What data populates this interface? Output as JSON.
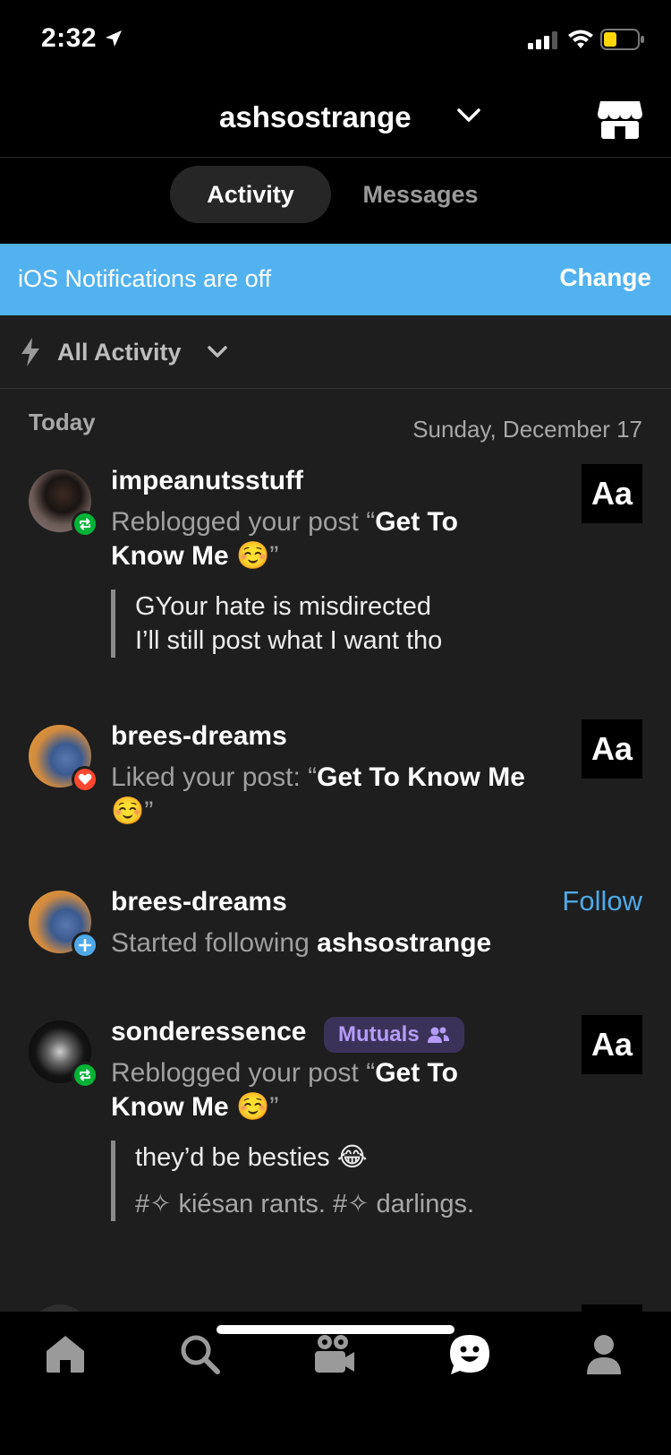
{
  "status_bar": {
    "time": "2:32"
  },
  "header": {
    "title": "ashsostrange"
  },
  "tabs": [
    {
      "label": "Activity",
      "selected": true
    },
    {
      "label": "Messages",
      "selected": false
    }
  ],
  "banner": {
    "text": "iOS Notifications are off",
    "action": "Change",
    "color": "#52b2f0"
  },
  "filter": {
    "label": "All Activity"
  },
  "section": {
    "label": "Today",
    "date": "Sunday, December 17"
  },
  "items": [
    {
      "username": "impeanutsstuff",
      "action_prefix": "Reblogged your post “",
      "post_title": "Get To Know Me ☺️",
      "action_suffix": "”",
      "badge": "reblog-icon",
      "thumb": "Aa",
      "quote_line1": "GYour hate is misdirected",
      "quote_line2": "I’ll still post what I want tho"
    },
    {
      "username": "brees-dreams",
      "action_prefix": "Liked your post: “",
      "post_title": "Get To Know Me",
      "post_emoji": "☺️",
      "action_suffix": "”",
      "badge": "heart-icon",
      "thumb": "Aa"
    },
    {
      "username": "brees-dreams",
      "action_prefix": "Started following ",
      "target": "ashsostrange",
      "badge": "plus-icon",
      "follow_label": "Follow"
    },
    {
      "username": "sonderessence",
      "mutuals_label": "Mutuals",
      "action_prefix": "Reblogged your post “",
      "post_title": "Get To Know Me ☺️",
      "action_suffix": "”",
      "badge": "reblog-icon",
      "thumb": "Aa",
      "quote_line1": "they’d be besties 😂",
      "quote_tags": "#✧ kiésan rants. #✧ darlings."
    }
  ],
  "nav": [
    "home-icon",
    "search-icon",
    "video-icon",
    "activity-icon",
    "profile-icon"
  ],
  "colors": {
    "accent": "#52b2f0",
    "reblog": "#00b336",
    "like": "#ff492f",
    "follow": "#4fa9e8",
    "mutuals": "#b49cf7"
  }
}
